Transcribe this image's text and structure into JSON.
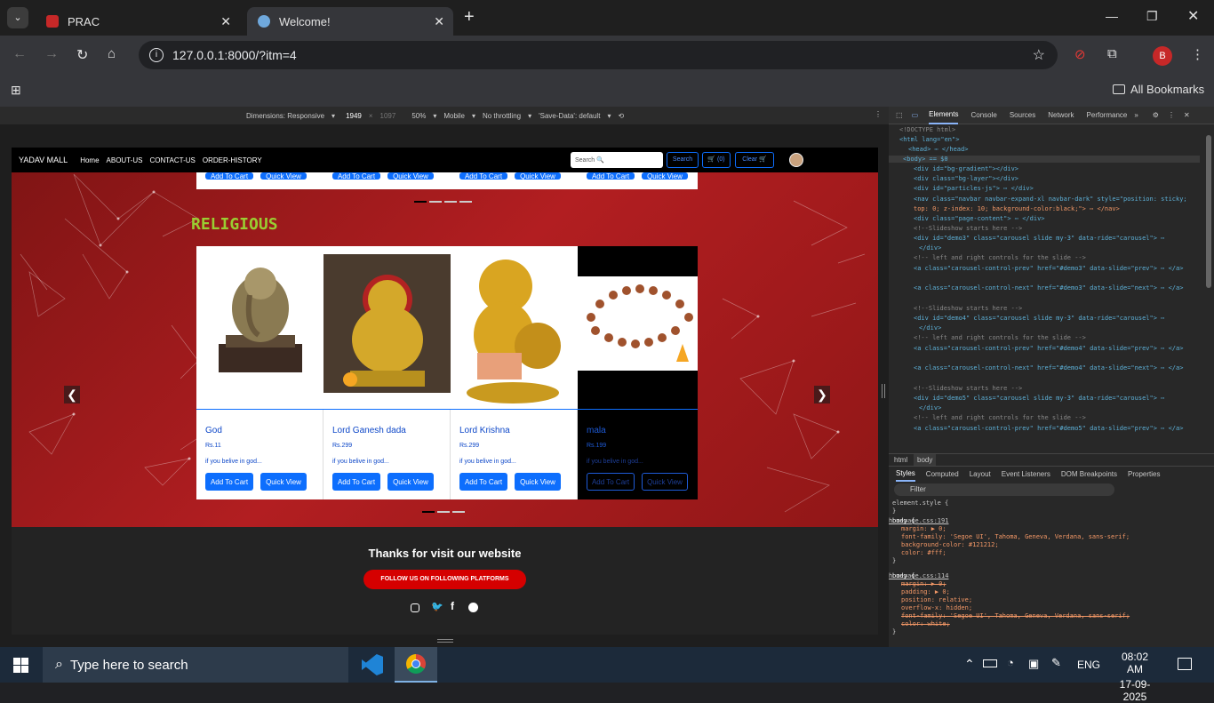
{
  "browser": {
    "tabs": [
      {
        "label": "PRAC"
      },
      {
        "label": "Welcome!"
      }
    ],
    "url": "127.0.0.1:8000/?itm=4",
    "bookmarks_label": "All Bookmarks",
    "profile_letter": "B"
  },
  "device_toolbar": {
    "dimensions": "Dimensions: Responsive",
    "width": "1949",
    "height": "1097",
    "zoom": "50%",
    "device": "Mobile",
    "throttle": "No throttling",
    "savedata": "'Save-Data': default"
  },
  "site": {
    "brand": "YADAV MALL",
    "nav": [
      "Home",
      "ABOUT-US",
      "CONTACT-US",
      "ORDER-HISTORY"
    ],
    "search_placeholder": "Search 🔍",
    "search_btn": "Search",
    "cart_btn": "🛒 (0)",
    "clear_btn": "Clear 🛒",
    "top_buttons": [
      "Add To Cart",
      "Quick View"
    ],
    "section_title": "RELIGIOUS",
    "products": [
      {
        "name": "God",
        "price": "Rs.11",
        "desc": "if you belive in god...",
        "add": "Add To Cart",
        "view": "Quick View"
      },
      {
        "name": "Lord Ganesh dada",
        "price": "Rs.299",
        "desc": "if you belive in god...",
        "add": "Add To Cart",
        "view": "Quick View"
      },
      {
        "name": "Lord Krishna",
        "price": "Rs.299",
        "desc": "if you belive in god...",
        "add": "Add To Cart",
        "view": "Quick View"
      },
      {
        "name": "mala",
        "price": "Rs.199",
        "desc": "if you belive in god...",
        "add": "Add To Cart",
        "view": "Quick View"
      }
    ],
    "footer_title": "Thanks for visit our website",
    "footer_btn": "FOLLOW US ON FOLLOWING PLATFORMS"
  },
  "devtools": {
    "tabs": [
      "Elements",
      "Console",
      "Sources",
      "Network",
      "Performance"
    ],
    "dom_lines": [
      "<!DOCTYPE html>",
      "<html lang=\"en\">",
      "<head> ⋯ </head>",
      "<body> == $0",
      "<div id=\"bg-gradient\"></div>",
      "<div class=\"bg-layer\"></div>",
      "<div id=\"particles-js\"> ⋯ </div>",
      "<nav class=\"navbar navbar-expand-xl navbar-dark\" style=\"position: sticky;",
      "top: 0; z-index: 10; background-color:black;\"> ⋯ </nav>",
      "<div class=\"page-content\"> ⋯ </div>",
      "<!--Slideshow starts here -->",
      "<div id=\"demo3\" class=\"carousel slide my-3\" data-ride=\"carousel\"> ⋯",
      "</div>",
      "<!-- left and right controls for the slide -->",
      "<a class=\"carousel-control-prev\" href=\"#demo3\" data-slide=\"prev\"> ⋯ </a>",
      "<a class=\"carousel-control-next\" href=\"#demo3\" data-slide=\"next\"> ⋯ </a>",
      "<!--Slideshow starts here -->",
      "<div id=\"demo4\" class=\"carousel slide my-3\" data-ride=\"carousel\"> ⋯",
      "</div>",
      "<!-- left and right controls for the slide -->",
      "<a class=\"carousel-control-prev\" href=\"#demo4\" data-slide=\"prev\"> ⋯ </a>",
      "<a class=\"carousel-control-next\" href=\"#demo4\" data-slide=\"next\"> ⋯ </a>",
      "<!--Slideshow starts here -->",
      "<div id=\"demo5\" class=\"carousel slide my-3\" data-ride=\"carousel\"> ⋯",
      "</div>",
      "<!-- left and right controls for the slide -->",
      "<a class=\"carousel-control-prev\" href=\"#demo5\" data-slide=\"prev\"> ⋯ </a>"
    ],
    "breadcrumb": [
      "html",
      "body"
    ],
    "style_tabs": [
      "Styles",
      "Computed",
      "Layout",
      "Event Listeners",
      "DOM Breakpoints",
      "Properties"
    ],
    "filter_placeholder": "Filter",
    "styles_lines": [
      "element.style {",
      "}",
      "body {",
      "margin: ▶ 0;",
      "font-family: 'Segoe UI', Tahoma, Geneva, Verdana, sans-serif;",
      "background-color: #121212;",
      "color: #fff;",
      "}",
      "body {",
      "margin: ▶ 0;",
      "padding: ▶ 0;",
      "position: relative;",
      "overflow-x: hidden;",
      "font-family: 'Segoe UI', Tahoma, Geneva, Verdana, sans-serif;",
      "color: white;",
      "}"
    ],
    "css_source_1": "homepage.css:191",
    "css_source_2": "homepage.css:114"
  },
  "taskbar": {
    "search_placeholder": "Type here to search",
    "lang": "ENG",
    "time": "08:02 AM",
    "date": "17-09-2025"
  }
}
